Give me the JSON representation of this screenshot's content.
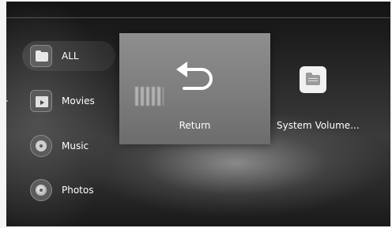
{
  "sidebar": {
    "items": [
      {
        "label": "ALL",
        "icon": "folder-icon",
        "active": true
      },
      {
        "label": "Movies",
        "icon": "movie-icon",
        "active": false
      },
      {
        "label": "Music",
        "icon": "music-disc-icon",
        "active": false
      },
      {
        "label": "Photos",
        "icon": "photo-icon",
        "active": false
      }
    ]
  },
  "grid": {
    "items": [
      {
        "label": "Return",
        "icon": "return-arrow-icon",
        "focused": true
      },
      {
        "label": "System Volume...",
        "icon": "folder-icon",
        "focused": false
      }
    ]
  },
  "colors": {
    "text": "#ffffff",
    "focused_tile": "#858585",
    "background_dark": "#1c1c1c"
  }
}
